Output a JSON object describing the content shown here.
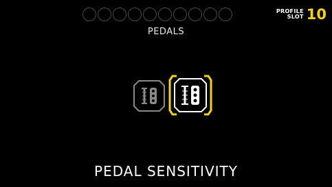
{
  "header": {
    "slots_total": 10,
    "title": "PEDALS",
    "profile_line1": "PROFILE",
    "profile_line2": "SLOT",
    "profile_number": "10"
  },
  "pedal_options": [
    {
      "name": "pedal-setting-1",
      "selected": false
    },
    {
      "name": "pedal-setting-2",
      "selected": true
    }
  ],
  "footer": {
    "label": "PEDAL SENSITIVITY"
  },
  "colors": {
    "accent": "#f2d21b",
    "inactive": "#7a7a7a",
    "background": "#000000"
  }
}
